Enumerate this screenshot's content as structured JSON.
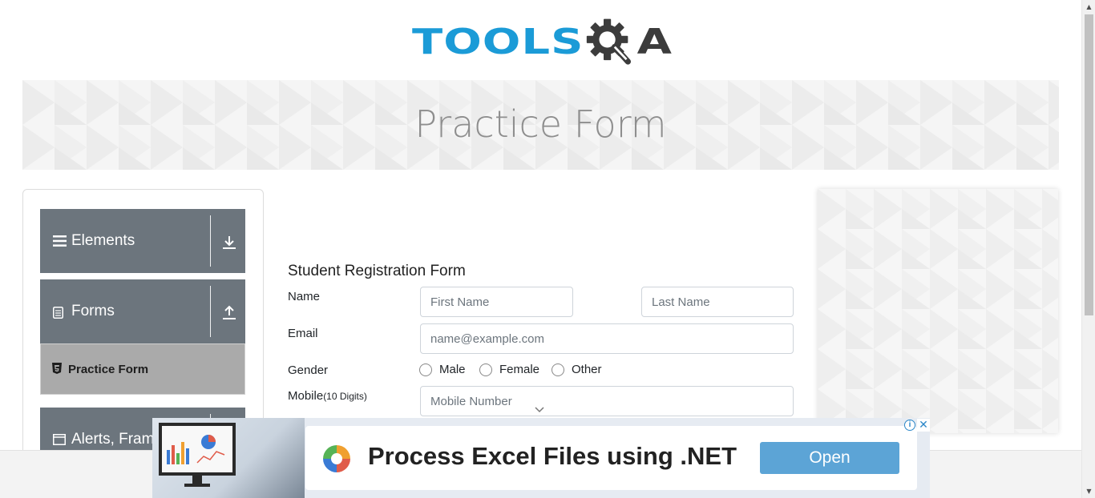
{
  "header": {
    "logo_text_left": "TOOLS",
    "logo_text_right": "A",
    "logo_icon": "gear-magnifier-icon"
  },
  "banner": {
    "title": "Practice Form"
  },
  "sidebar": {
    "groups": [
      {
        "label": "Elements",
        "icon": "hamburger-icon",
        "toggle_icon": "download-arrow-icon"
      },
      {
        "label": "Forms",
        "icon": "document-icon",
        "toggle_icon": "upload-arrow-icon"
      },
      {
        "label": "Alerts, Fram",
        "icon": "window-icon"
      }
    ],
    "active_item": {
      "label": "Practice Form",
      "icon": "html5-icon"
    }
  },
  "form": {
    "title": "Student Registration Form",
    "name_label": "Name",
    "first_name_placeholder": "First Name",
    "last_name_placeholder": "Last Name",
    "email_label": "Email",
    "email_placeholder": "name@example.com",
    "gender_label": "Gender",
    "genders": [
      "Male",
      "Female",
      "Other"
    ],
    "mobile_label": "Mobile",
    "mobile_hint": "(10 Digits)",
    "mobile_placeholder": "Mobile Number"
  },
  "ad": {
    "title": "Process Excel Files using .NET",
    "button": "Open",
    "info_icon": "i",
    "close_icon": "✕"
  },
  "colors": {
    "brand_blue": "#1b9bd7",
    "sidebar_group": "#6c757d",
    "sidebar_active": "#aaaaaa",
    "ad_button": "#5ca4d6"
  }
}
